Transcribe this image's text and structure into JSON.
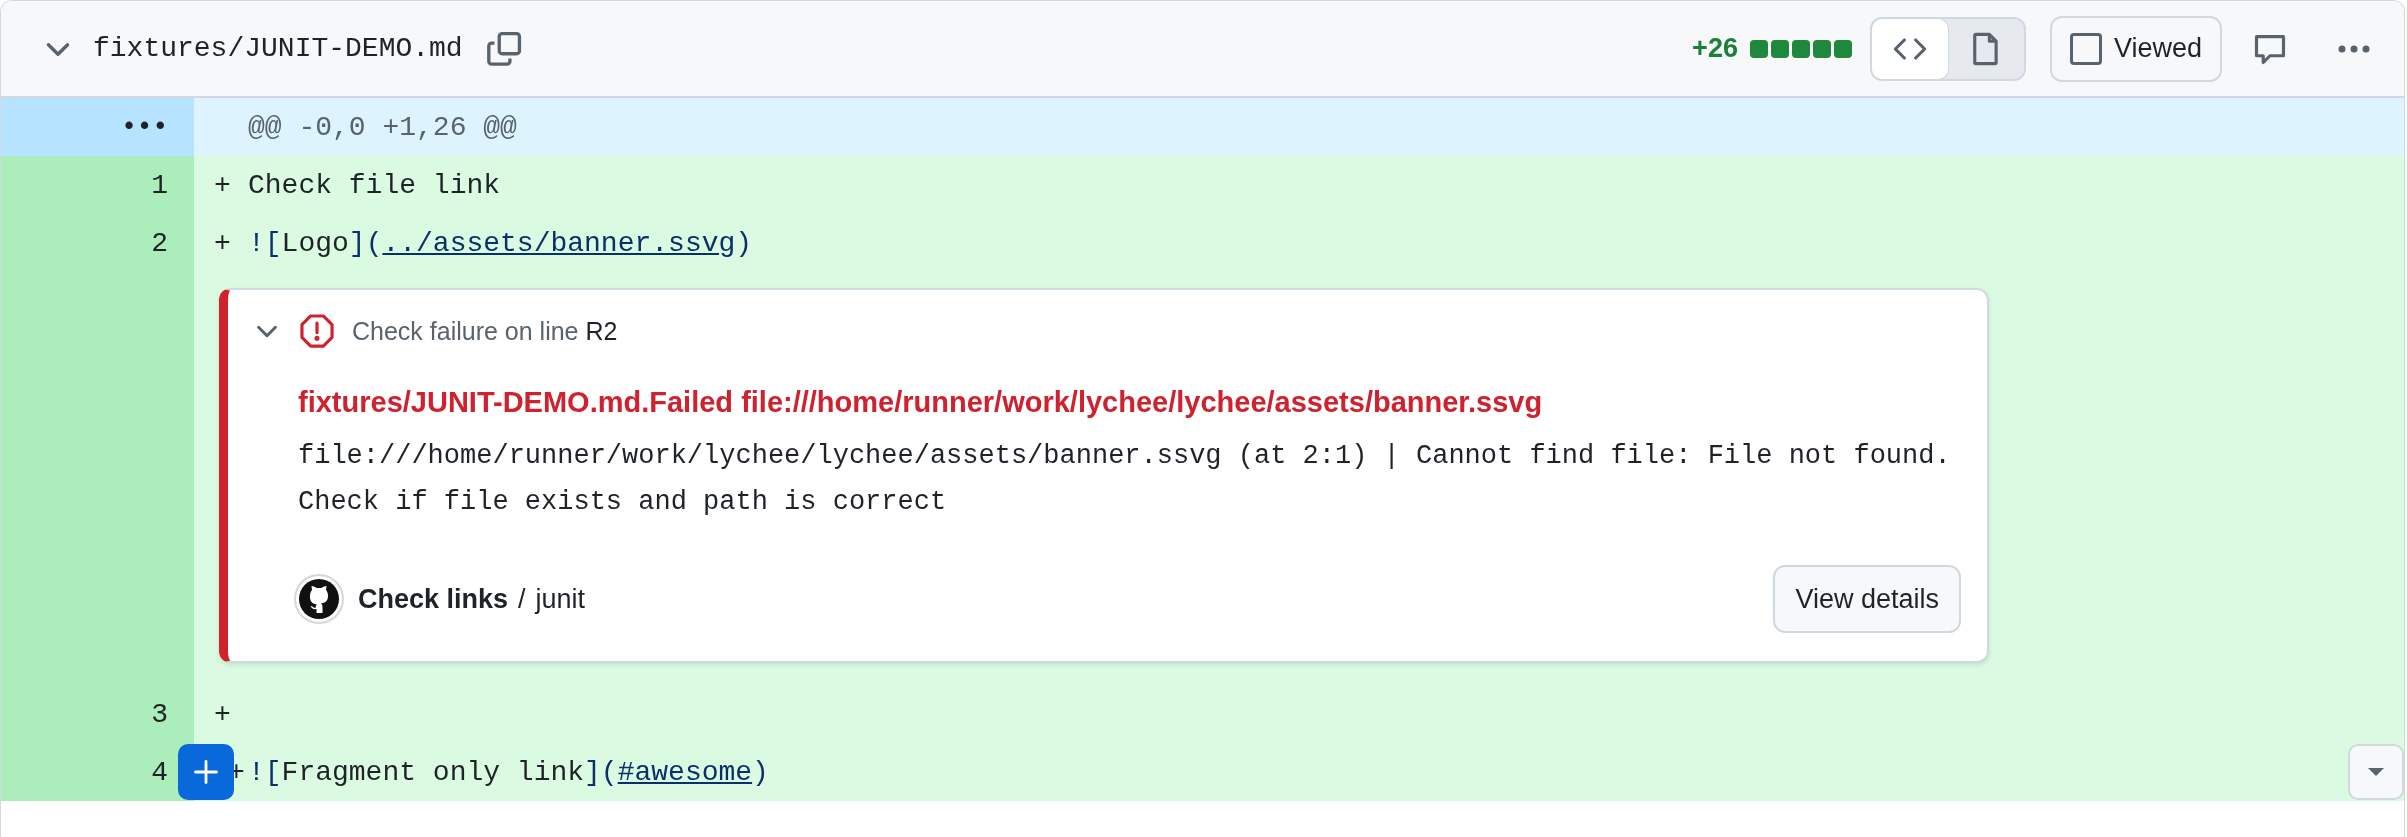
{
  "file_header": {
    "expanded": true,
    "filename": "fixtures/JUNIT-DEMO.md",
    "additions": "+26",
    "diffstat_blocks": [
      {
        "kind": "added"
      },
      {
        "kind": "added"
      },
      {
        "kind": "added"
      },
      {
        "kind": "added"
      },
      {
        "kind": "added"
      }
    ],
    "view_toggle": [
      {
        "kind": "code",
        "selected": true
      },
      {
        "kind": "file",
        "selected": false
      }
    ],
    "viewed": {
      "label": "Viewed",
      "checked": false
    }
  },
  "hunk": {
    "expander": "•••",
    "header": "@@ -0,0 +1,26 @@"
  },
  "lines": [
    {
      "kind": "line",
      "number": "1",
      "marker": "+",
      "segments": [
        {
          "kind": "text",
          "text": "Check file link"
        }
      ]
    },
    {
      "kind": "line",
      "number": "2",
      "marker": "+",
      "segments": [
        {
          "kind": "punct",
          "text": "!["
        },
        {
          "kind": "text",
          "text": "Logo"
        },
        {
          "kind": "punct",
          "text": "]("
        },
        {
          "kind": "link",
          "text": "../assets/banner.ssvg"
        },
        {
          "kind": "punct",
          "text": ")"
        }
      ]
    },
    {
      "kind": "annotation",
      "expanded": true,
      "heading": "Check failure on line",
      "line_ref": "R2",
      "title": "fixtures/JUNIT-DEMO.md.Failed file:///home/runner/work/lychee/lychee/assets/banner.ssvg",
      "message": "file:///home/runner/work/lychee/lychee/assets/banner.ssvg (at 2:1) | Cannot find file: File not found. Check if file exists and path is correct",
      "check_name": "Check links",
      "separator": "/",
      "job": "junit",
      "button": "View details"
    },
    {
      "kind": "line",
      "number": "3",
      "marker": "+"
    },
    {
      "kind": "line",
      "number": "4",
      "marker": "+",
      "comment_button": true,
      "scroll_button": true,
      "segments": [
        {
          "kind": "punct",
          "text": "!["
        },
        {
          "kind": "text",
          "text": "Fragment only link"
        },
        {
          "kind": "punct",
          "text": "]("
        },
        {
          "kind": "link",
          "text": "#awesome"
        },
        {
          "kind": "punct",
          "text": ")"
        }
      ]
    }
  ]
}
